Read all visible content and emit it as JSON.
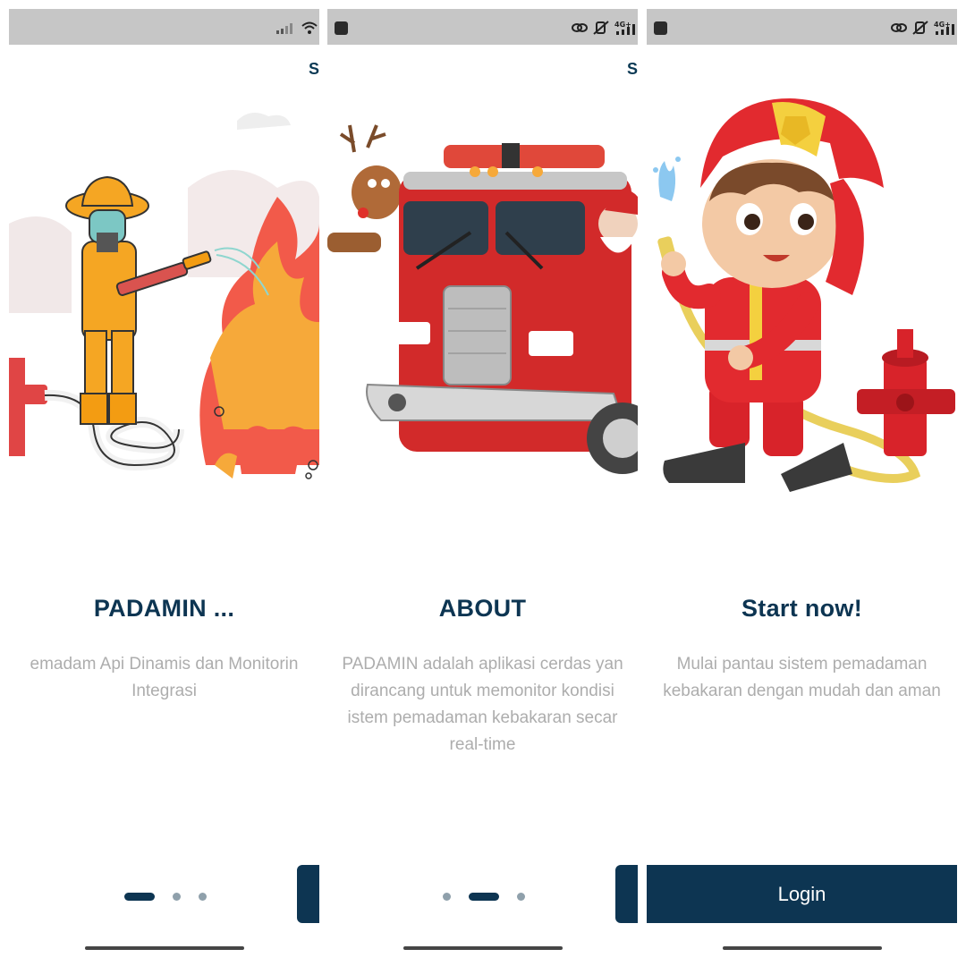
{
  "colors": {
    "primary": "#0d3552",
    "status_bar": "#c6c6c6",
    "text_muted": "#adadad"
  },
  "skip_label": "S",
  "screens": [
    {
      "title": "PADAMIN ...",
      "description_lines": [
        "emadam Api Dinamis dan Monitorin",
        "Integrasi"
      ],
      "illustration": "firefighter-spraying-fire",
      "status_icons": [
        "signal-icon",
        "wifi-icon"
      ],
      "active_page": 0
    },
    {
      "title": "ABOUT",
      "description_lines": [
        "PADAMIN adalah aplikasi cerdas yan",
        "dirancang untuk memonitor kondisi",
        "istem pemadaman kebakaran secar",
        "real-time"
      ],
      "illustration": "fire-truck-with-reindeer-and-santa",
      "status_icons": [
        "link-icon",
        "mute-icon",
        "4g-signal-icon"
      ],
      "status_network": "4G+",
      "active_page": 1
    },
    {
      "title": "Start now!",
      "description_lines": [
        "Mulai pantau sistem pemadaman",
        "kebakaran dengan mudah dan aman"
      ],
      "illustration": "kid-firefighter-with-hydrant",
      "status_icons": [
        "link-icon",
        "mute-icon",
        "4g-signal-icon"
      ],
      "status_network": "4G+",
      "login_label": "Login"
    }
  ],
  "page_count": 3
}
